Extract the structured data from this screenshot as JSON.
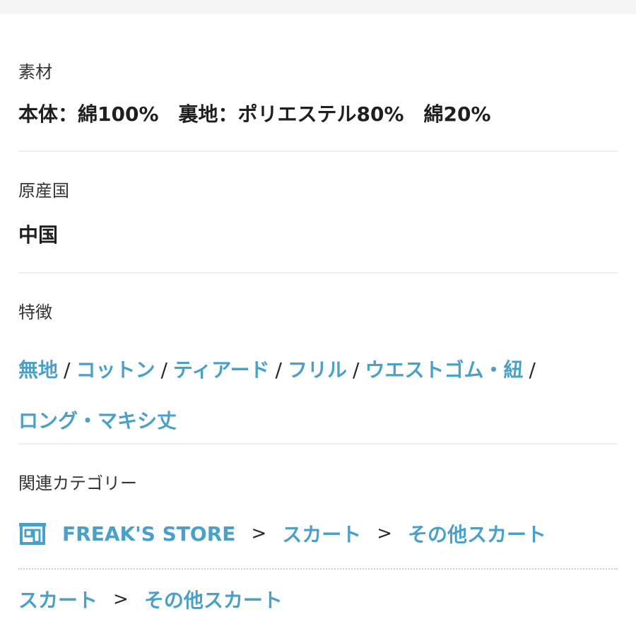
{
  "material": {
    "label": "素材",
    "value": "本体：綿100%　裏地：ポリエステル80%　綿20%"
  },
  "origin": {
    "label": "原産国",
    "value": "中国"
  },
  "features": {
    "label": "特徴",
    "tags": [
      "無地",
      "コットン",
      "ティアード",
      "フリル",
      "ウエストゴム・紐",
      "ロング・マキシ丈"
    ],
    "separator": "/"
  },
  "related": {
    "label": "関連カテゴリー",
    "store_path": [
      "FREAK'S STORE",
      "スカート",
      "その他スカート"
    ],
    "category_path": [
      "スカート",
      "その他スカート"
    ],
    "arrow": ">"
  },
  "colors": {
    "link": "#4aa0c9",
    "text": "#222222"
  }
}
